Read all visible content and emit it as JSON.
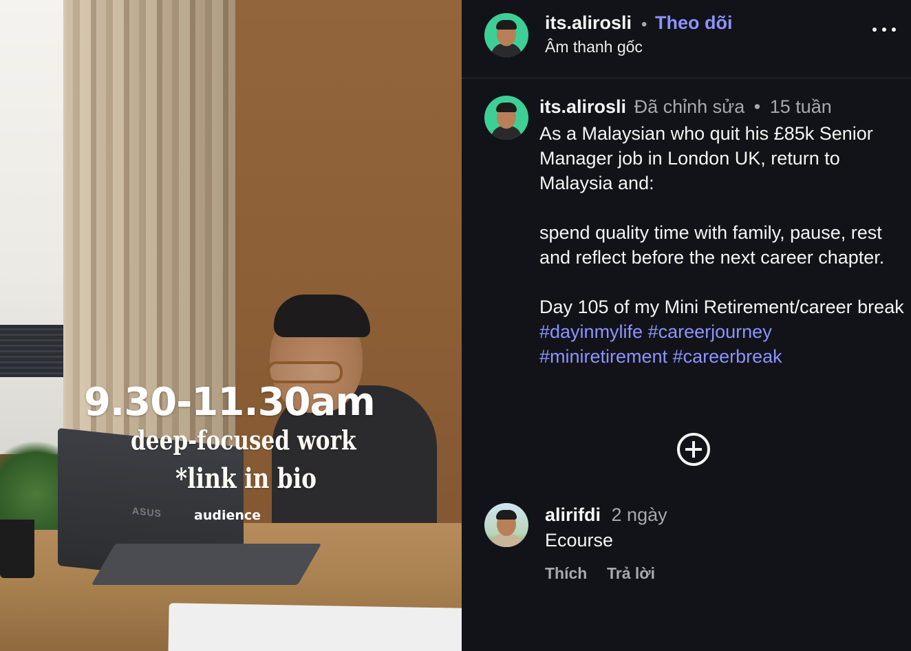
{
  "video": {
    "overlay_time": "9.30-11.30am",
    "overlay_line1": "deep-focused work",
    "overlay_line2": "*link in bio",
    "overlay_audience": "audience",
    "laptop_brand": "ASUS"
  },
  "header": {
    "username": "its.alirosli",
    "separator": "•",
    "follow_label": "Theo dõi",
    "audio_label": "Âm thanh gốc",
    "more_icon": "more-horizontal-icon"
  },
  "caption": {
    "username": "its.alirosli",
    "edited_label": "Đã chỉnh sửa",
    "separator": "•",
    "time": "15 tuần",
    "paragraph1": "As a Malaysian who quit his £85k Senior Manager job in London UK, return to Malaysia and:",
    "paragraph2": "spend quality time with family, pause, rest and reflect before the next career chapter.",
    "paragraph3_text": "Day 105 of my Mini Retirement/career break",
    "hashtags": [
      "#dayinmylife",
      "#careerjourney",
      "#miniretirement",
      "#careerbreak"
    ]
  },
  "load_more_icon": "plus-circle-icon",
  "comment": {
    "username": "alirifdi",
    "time": "2 ngày",
    "text": "Ecourse",
    "like_label": "Thích",
    "reply_label": "Trả lời"
  },
  "colors": {
    "background": "#121318",
    "accent": "#8c93ff",
    "muted_text": "#a8a8b0",
    "primary_text": "#f5f5f5"
  }
}
